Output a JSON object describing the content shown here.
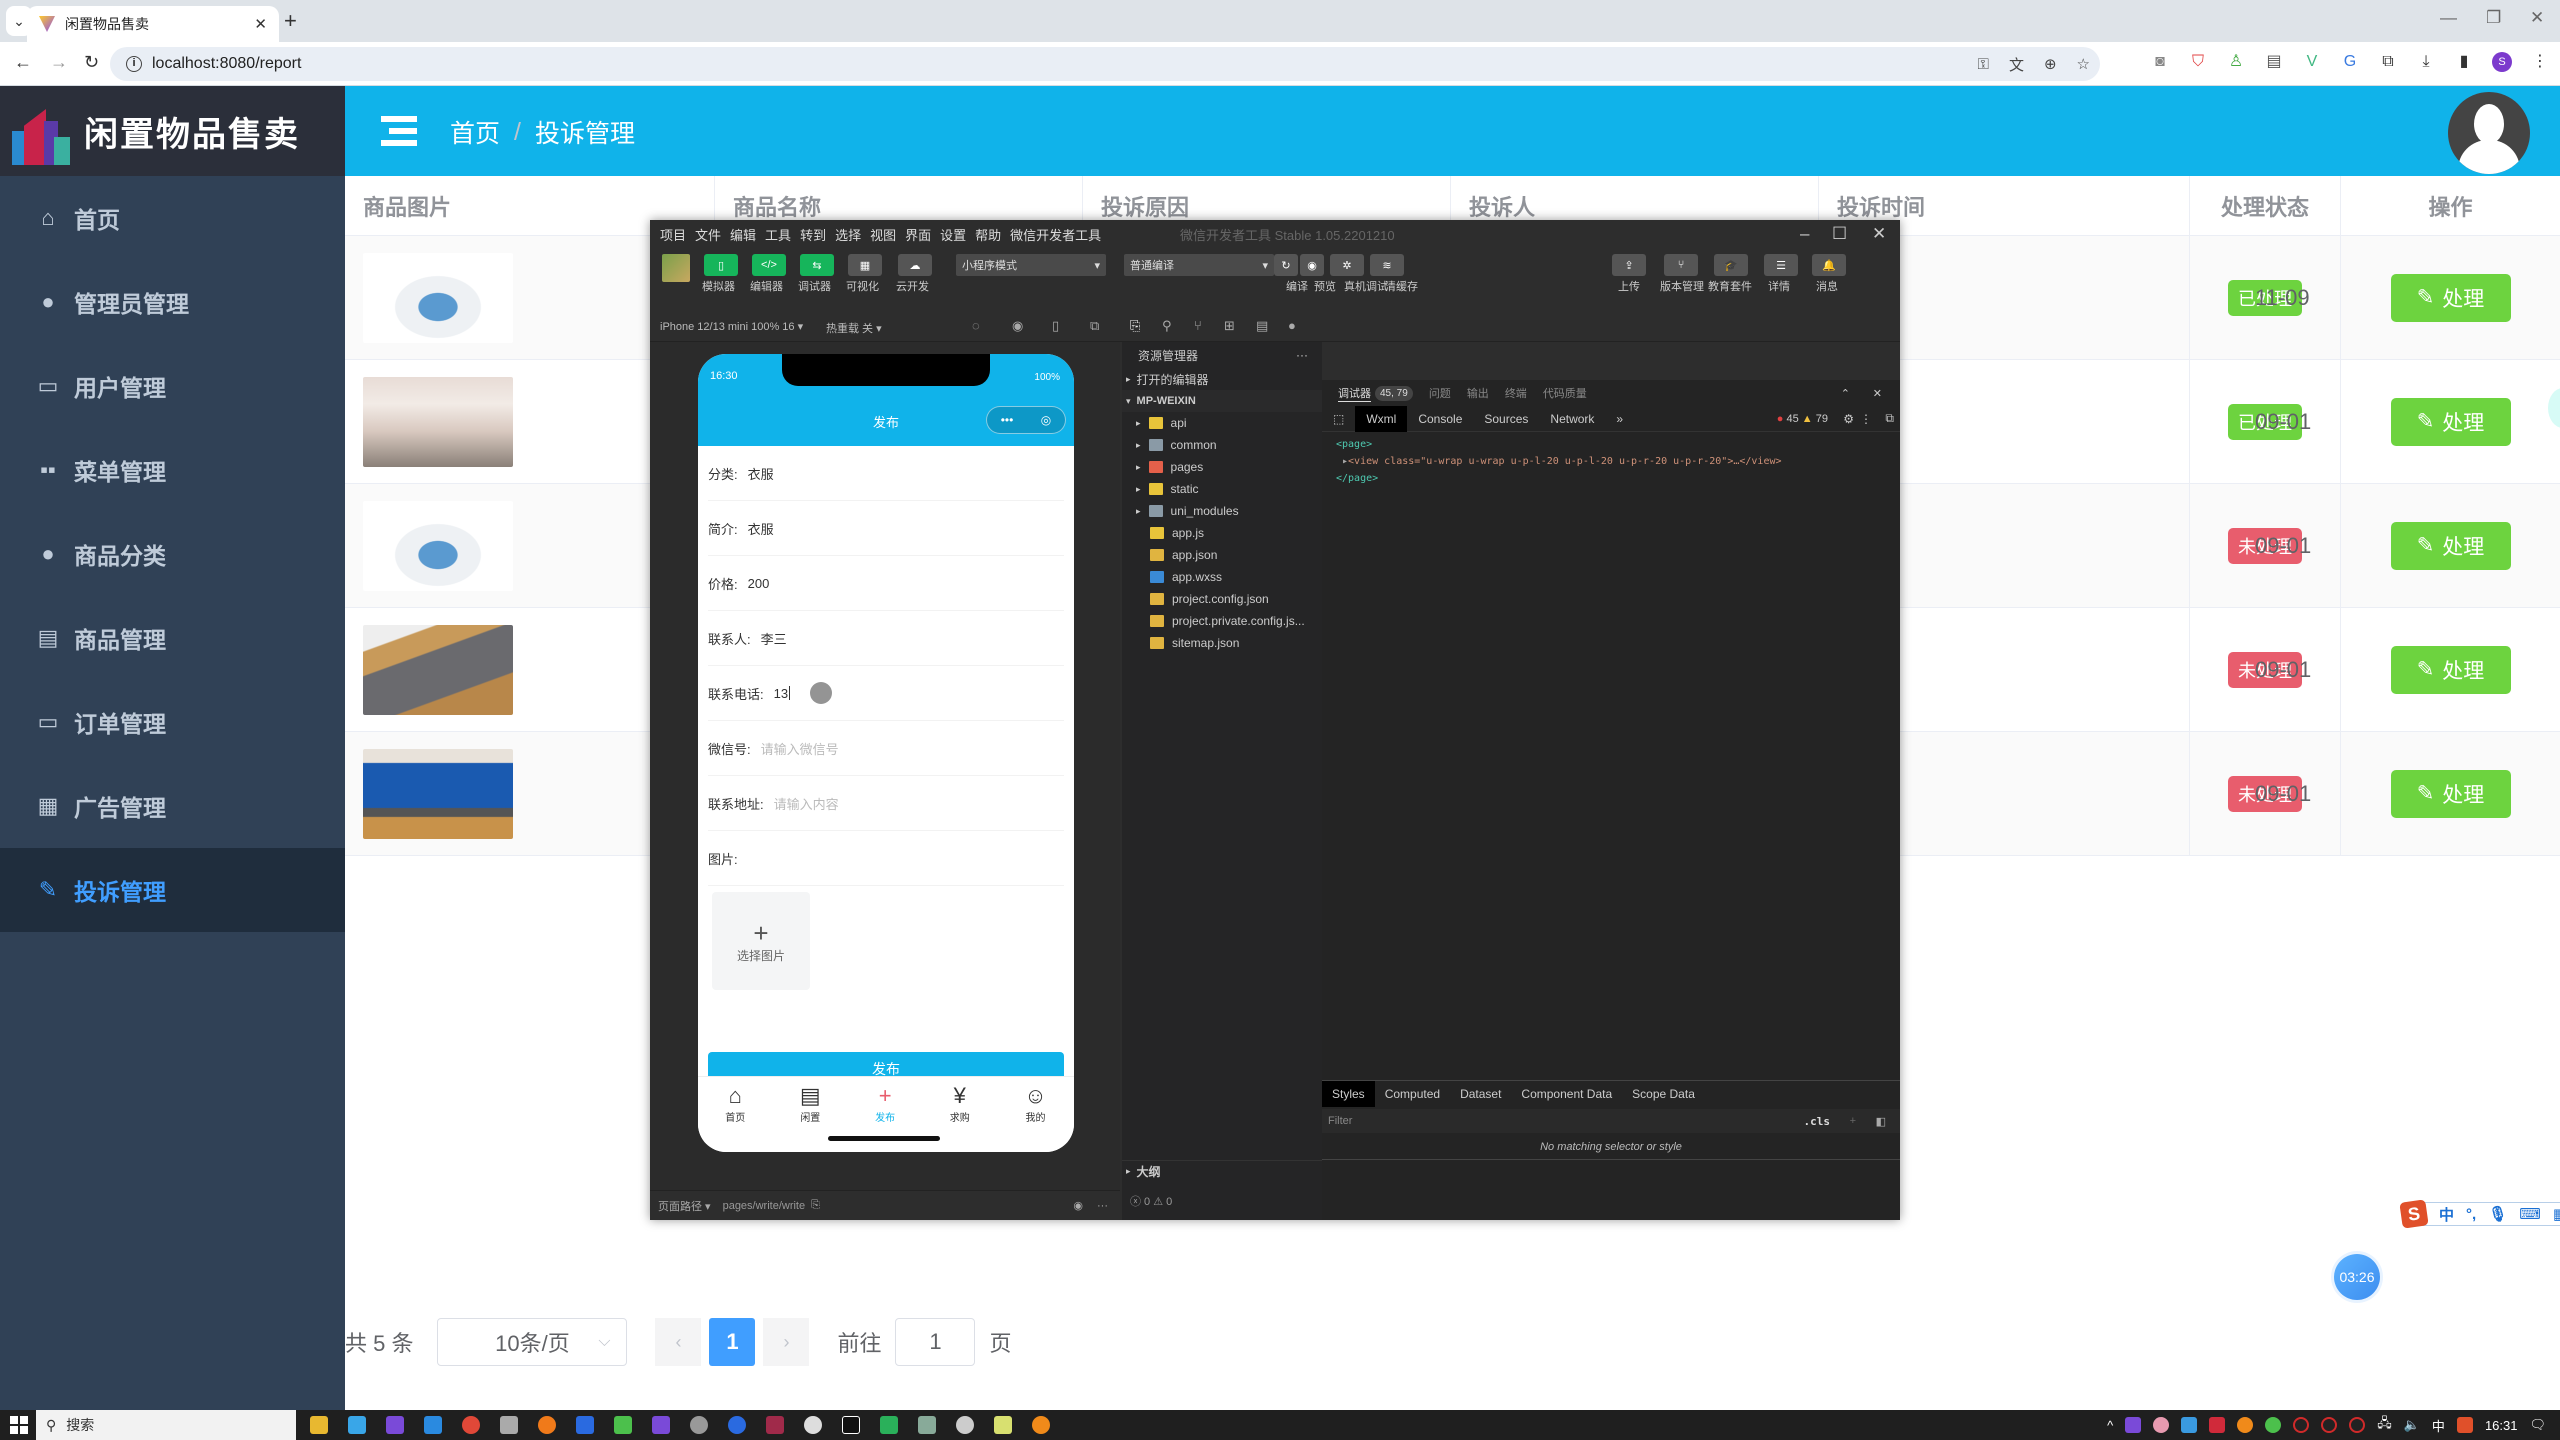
{
  "browser": {
    "tab_title": "闲置物品售卖",
    "url": "localhost:8080/report",
    "profile_initial": "S"
  },
  "app": {
    "title": "闲置物品售卖",
    "breadcrumb": [
      "首页",
      "投诉管理"
    ],
    "breadcrumb_sep": "/"
  },
  "sidebar": {
    "items": [
      {
        "label": "首页",
        "icon": "home-icon"
      },
      {
        "label": "管理员管理",
        "icon": "user-icon"
      },
      {
        "label": "用户管理",
        "icon": "wallet-icon"
      },
      {
        "label": "菜单管理",
        "icon": "grid-icon"
      },
      {
        "label": "商品分类",
        "icon": "user-icon"
      },
      {
        "label": "商品管理",
        "icon": "list-icon"
      },
      {
        "label": "订单管理",
        "icon": "monitor-icon"
      },
      {
        "label": "广告管理",
        "icon": "calendar-icon"
      },
      {
        "label": "投诉管理",
        "icon": "edit-icon",
        "active": true
      }
    ]
  },
  "table": {
    "headers": [
      "商品图片",
      "商品名称",
      "投诉原因",
      "投诉人",
      "投诉时间",
      "处理状态",
      "操作"
    ],
    "rows": [
      {
        "image": "sneakers",
        "time_visible": "11-09",
        "status": "已处理",
        "status_type": "done",
        "action": "处理"
      },
      {
        "image": "dress",
        "time_visible": "09-01",
        "status": "已处理",
        "status_type": "done",
        "action": "处理"
      },
      {
        "image": "sneakers",
        "time_visible": "09-01",
        "status": "未处理",
        "status_type": "todo",
        "action": "处理"
      },
      {
        "image": "iphone",
        "time_visible": "09-01",
        "status": "未处理",
        "status_type": "todo",
        "action": "处理"
      },
      {
        "image": "laptop",
        "time_visible": "09-01",
        "status": "未处理",
        "status_type": "todo",
        "action": "处理"
      }
    ]
  },
  "pagination": {
    "total_label": "共 5 条",
    "page_size": "10条/页",
    "current_page": "1",
    "goto_label": "前往",
    "goto_value": "1",
    "page_suffix": "页"
  },
  "devtools": {
    "menu": [
      "项目",
      "文件",
      "编辑",
      "工具",
      "转到",
      "选择",
      "视图",
      "界面",
      "设置",
      "帮助",
      "微信开发者工具"
    ],
    "version": "微信开发者工具 Stable 1.05.2201210",
    "toolbar_left": [
      "模拟器",
      "编辑器",
      "调试器",
      "可视化",
      "云开发"
    ],
    "mode_select": "小程序模式",
    "compile_select": "普通编译",
    "toolbar_mid": [
      "编译",
      "预览",
      "真机调试",
      "清缓存"
    ],
    "toolbar_right": [
      "上传",
      "版本管理",
      "教育套件",
      "详情",
      "消息"
    ],
    "device": "iPhone 12/13 mini 100% 16 ▾",
    "hot_reload": "热重载 关 ▾",
    "explorer_title": "资源管理器",
    "explorer_open_editors": "打开的编辑器",
    "explorer_root": "MP-WEIXIN",
    "files": [
      {
        "name": "api",
        "type": "folder",
        "color": "#e8c43a"
      },
      {
        "name": "common",
        "type": "folder",
        "color": "#8a9aa6"
      },
      {
        "name": "pages",
        "type": "folder",
        "color": "#e5604a"
      },
      {
        "name": "static",
        "type": "folder",
        "color": "#e8c43a"
      },
      {
        "name": "uni_modules",
        "type": "folder",
        "color": "#8a9aa6"
      },
      {
        "name": "app.js",
        "type": "js",
        "color": "#e8c43a"
      },
      {
        "name": "app.json",
        "type": "json",
        "color": "#e0b440"
      },
      {
        "name": "app.wxss",
        "type": "css",
        "color": "#3a8ad6"
      },
      {
        "name": "project.config.json",
        "type": "json",
        "color": "#e0b440"
      },
      {
        "name": "project.private.config.js...",
        "type": "json",
        "color": "#e0b440"
      },
      {
        "name": "sitemap.json",
        "type": "json",
        "color": "#e0b440"
      }
    ],
    "outline": "大纲",
    "debugger_tabs": [
      "调试器",
      "问题",
      "输出",
      "终端",
      "代码质量"
    ],
    "debugger_badge": "45, 79",
    "panel_tabs": [
      "Wxml",
      "Console",
      "Sources",
      "Network",
      "»"
    ],
    "errors": "45",
    "warnings": "79",
    "wxml_lines": [
      "<page>",
      "<view class=\"u-wrap u-wrap u-p-l-20 u-p-l-20 u-p-r-20 u-p-r-20\">…</view>",
      "</page>"
    ],
    "style_tabs": [
      "Styles",
      "Computed",
      "Dataset",
      "Component Data",
      "Scope Data"
    ],
    "filter_placeholder": "Filter",
    "cls_label": ".cls",
    "no_match": "No matching selector or style",
    "page_path_label": "页面路径 ▾",
    "page_path": "pages/write/write",
    "issues": "ⓧ 0 ⚠ 0"
  },
  "phone": {
    "time": "16:30",
    "battery": "100%",
    "nav_title": "发布",
    "fields": [
      {
        "label": "分类:",
        "value": "衣服"
      },
      {
        "label": "简介:",
        "value": "衣服"
      },
      {
        "label": "价格:",
        "value": "200"
      },
      {
        "label": "联系人:",
        "value": "李三"
      },
      {
        "label": "联系电话:",
        "value": "13"
      },
      {
        "label": "微信号:",
        "placeholder": "请输入微信号"
      },
      {
        "label": "联系地址:",
        "placeholder": "请输入内容"
      },
      {
        "label": "图片:",
        "value": ""
      }
    ],
    "pick_image": "选择图片",
    "publish_button": "发布",
    "tabbar": [
      {
        "label": "首页",
        "icon": "⌂"
      },
      {
        "label": "闲置",
        "icon": "▤"
      },
      {
        "label": "发布",
        "icon": "+",
        "active": true
      },
      {
        "label": "求购",
        "icon": "¥"
      },
      {
        "label": "我的",
        "icon": "☺"
      }
    ]
  },
  "overlay": {
    "timer": "03:26",
    "ime_lang": "中"
  },
  "taskbar": {
    "search": "搜索",
    "clock": "16:31",
    "ime": "中"
  }
}
